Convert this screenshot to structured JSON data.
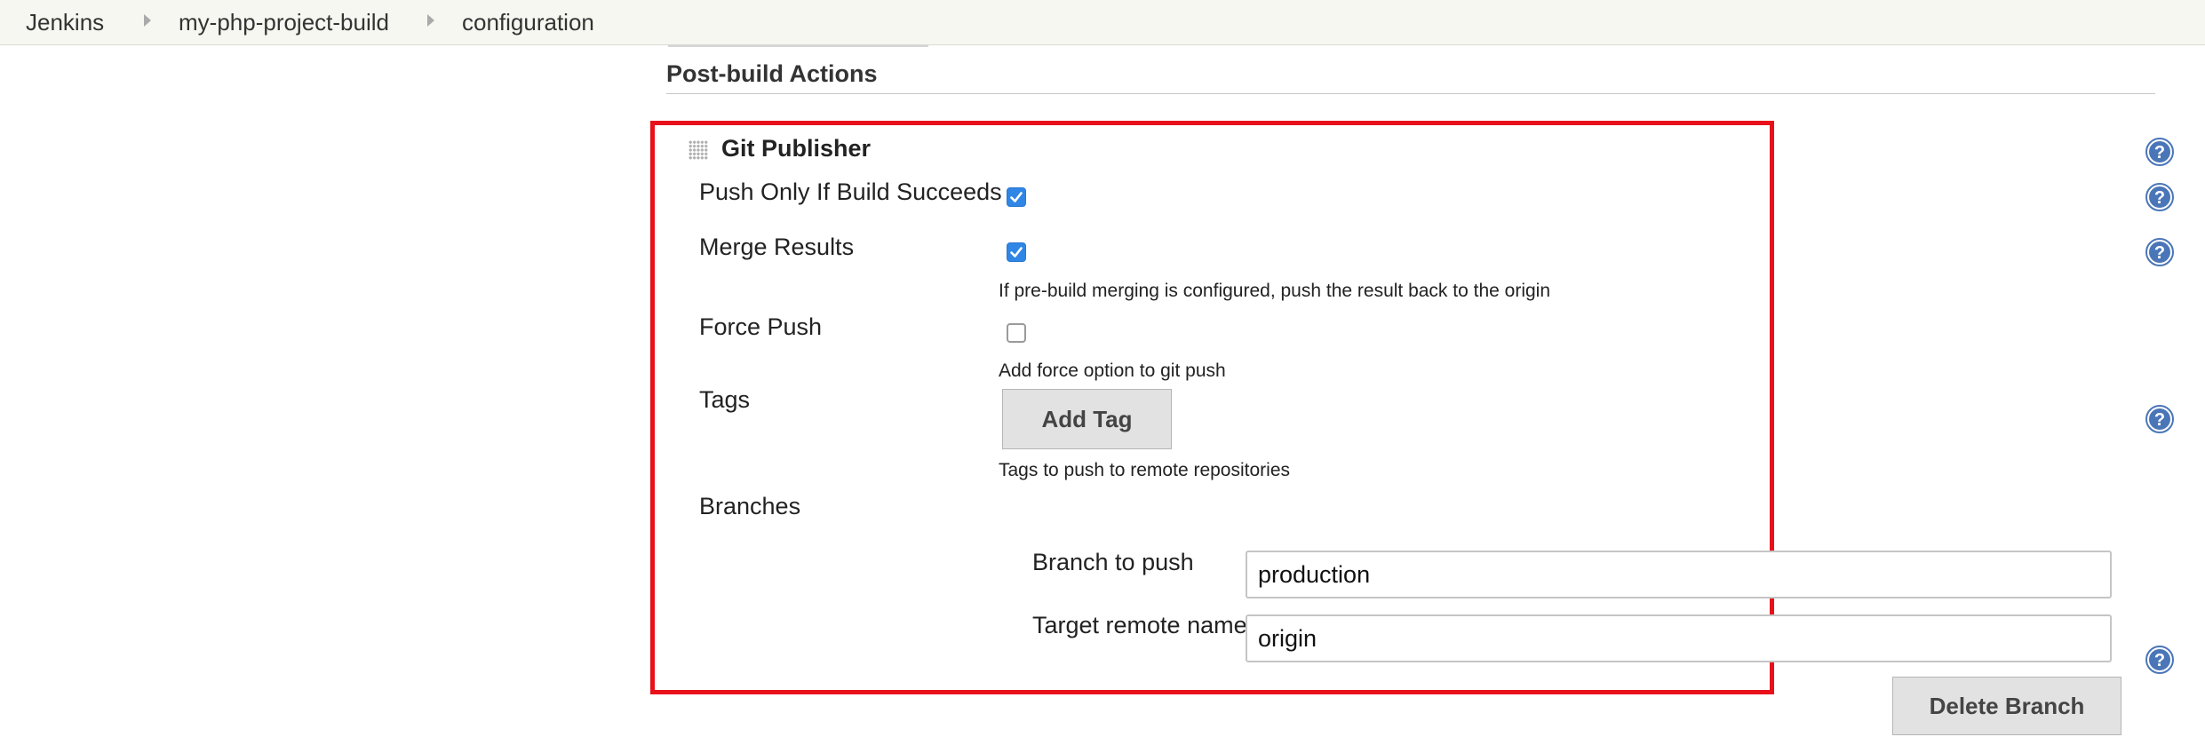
{
  "breadcrumb": [
    "Jenkins",
    "my-php-project-build",
    "configuration"
  ],
  "section": {
    "title": "Post-build Actions"
  },
  "publisher": {
    "title": "Git Publisher",
    "push_only": {
      "label": "Push Only If Build Succeeds",
      "checked": true
    },
    "merge_results": {
      "label": "Merge Results",
      "checked": true,
      "description": "If pre-build merging is configured, push the result back to the origin"
    },
    "force_push": {
      "label": "Force Push",
      "checked": false,
      "description": "Add force option to git push"
    },
    "tags": {
      "label": "Tags",
      "button": "Add Tag",
      "description": "Tags to push to remote repositories"
    },
    "branches": {
      "label": "Branches",
      "branch_to_push_label": "Branch to push",
      "branch_to_push_value": "production",
      "target_remote_label": "Target remote name",
      "target_remote_value": "origin",
      "delete_button": "Delete Branch"
    }
  },
  "colors": {
    "accent": "#2f86e6",
    "highlight": "#e8101a",
    "help": "#4a76b8"
  }
}
